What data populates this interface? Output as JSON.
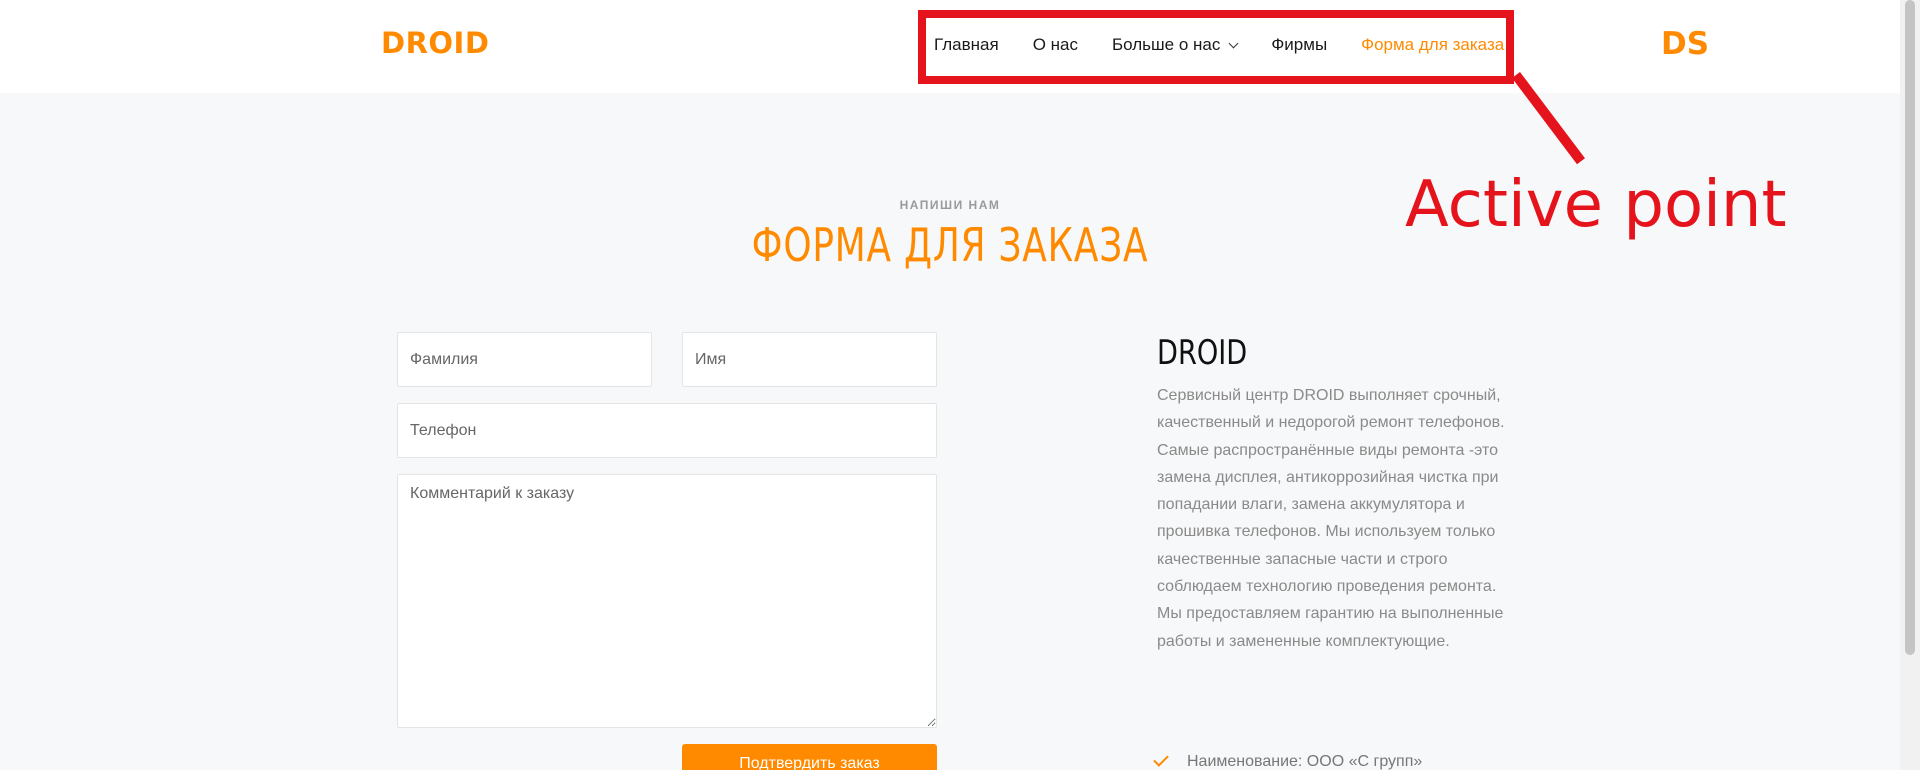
{
  "header": {
    "logo_left": "DROID",
    "logo_right": "DS"
  },
  "nav": {
    "items": [
      {
        "label": "Главная"
      },
      {
        "label": "О нас"
      },
      {
        "label": "Больше о нас"
      },
      {
        "label": "Фирмы"
      },
      {
        "label": "Форма для заказа",
        "active": true
      }
    ]
  },
  "annotation": {
    "label": "Active point",
    "color": "#e5141c"
  },
  "section": {
    "kicker": "НАПИШИ НАМ",
    "title": "ФОРМА ДЛЯ ЗАКАЗА"
  },
  "form": {
    "last_name_placeholder": "Фамилия",
    "first_name_placeholder": "Имя",
    "phone_placeholder": "Телефон",
    "comment_placeholder": "Комментарий к заказу",
    "submit_label": "Подтвердить заказ"
  },
  "info": {
    "title": "DROID",
    "text": "Сервисный центр DROID выполняет срочный, качественный и недорогой ремонт телефонов. Самые распространённые виды ремонта -это замена дисплея, антикоррозийная чистка при попадании влаги, замена аккумулятора и прошивка телефонов. Мы используем только качественные запасные части и строго соблюдаем технологию проведения ремонта. Мы предоставляем гарантию на выполненные работы и замененные комплектующие.",
    "company_row": "Наименование: ООО «С групп»"
  },
  "colors": {
    "accent": "#ff8a00",
    "background": "#f7f8f9"
  }
}
